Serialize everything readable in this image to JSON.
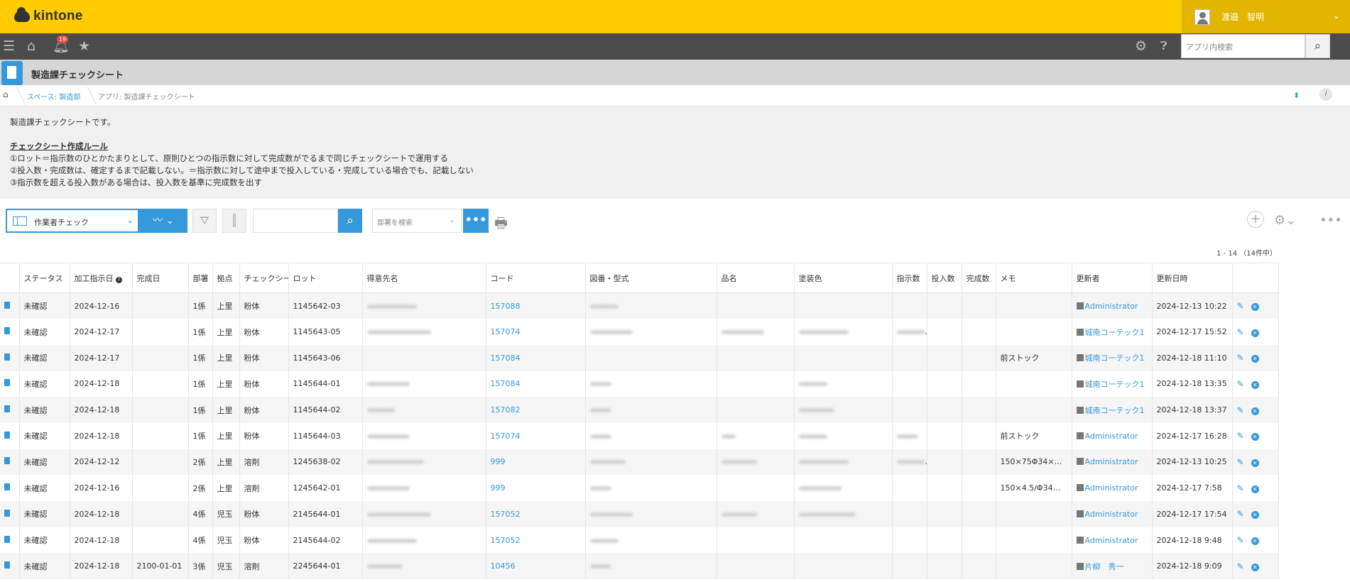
{
  "header": {
    "logo_text": "kintone",
    "user_name": "渡邉　智明"
  },
  "nav": {
    "notification_count": "19",
    "search_placeholder": "アプリ内検索"
  },
  "app": {
    "title": "製造課チェックシート"
  },
  "breadcrumb": {
    "space": "スペース: 製造部",
    "app": "アプリ: 製造課チェックシート"
  },
  "description": {
    "intro": "製造課チェックシートです。",
    "rule_title": "チェックシート作成ルール",
    "rules": [
      "①ロット＝指示数のひとかたまりとして、原則ひとつの指示数に対して完成数がでるまで同じチェックシートで運用する",
      "②投入数・完成数は、確定するまで記載しない。＝指示数に対して途中まで投入している・完成している場合でも、記載しない",
      "③指示数を超える投入数がある場合は、投入数を基準に完成数を出す"
    ]
  },
  "toolbar": {
    "view_name": "作業者チェック",
    "dept_placeholder": "部署を検索",
    "pager": "1 - 14 （14件中）"
  },
  "table": {
    "headers": [
      "ステータス",
      "加工指示日",
      "完成日",
      "部署",
      "拠点",
      "チェックシート",
      "ロット",
      "得意先名",
      "コード",
      "図番・型式",
      "品名",
      "塗装色",
      "指示数",
      "投入数",
      "完成数",
      "メモ",
      "更新者",
      "更新日時"
    ],
    "rows": [
      {
        "status": "未確認",
        "date": "2024-12-16",
        "done": "",
        "dept": "1係",
        "site": "上里",
        "sheet": "粉体",
        "lot": "1145642-03",
        "code": "157088",
        "memo": "",
        "updater": "Administrator",
        "updated": "2024-12-13 10:22"
      },
      {
        "status": "未確認",
        "date": "2024-12-17",
        "done": "",
        "dept": "1係",
        "site": "上里",
        "sheet": "粉体",
        "lot": "1145643-05",
        "code": "157074",
        "memo": "",
        "updater": "城南コーテック1",
        "updated": "2024-12-17 15:52"
      },
      {
        "status": "未確認",
        "date": "2024-12-17",
        "done": "",
        "dept": "1係",
        "site": "上里",
        "sheet": "粉体",
        "lot": "1145643-06",
        "code": "157084",
        "memo": "前ストック",
        "updater": "城南コーテック1",
        "updated": "2024-12-18 11:10"
      },
      {
        "status": "未確認",
        "date": "2024-12-18",
        "done": "",
        "dept": "1係",
        "site": "上里",
        "sheet": "粉体",
        "lot": "1145644-01",
        "code": "157084",
        "memo": "",
        "updater": "城南コーテック1",
        "updated": "2024-12-18 13:35"
      },
      {
        "status": "未確認",
        "date": "2024-12-18",
        "done": "",
        "dept": "1係",
        "site": "上里",
        "sheet": "粉体",
        "lot": "1145644-02",
        "code": "157082",
        "memo": "",
        "updater": "城南コーテック1",
        "updated": "2024-12-18 13:37"
      },
      {
        "status": "未確認",
        "date": "2024-12-18",
        "done": "",
        "dept": "1係",
        "site": "上里",
        "sheet": "粉体",
        "lot": "1145644-03",
        "code": "157074",
        "memo": "前ストック",
        "updater": "Administrator",
        "updated": "2024-12-17 16:28"
      },
      {
        "status": "未確認",
        "date": "2024-12-12",
        "done": "",
        "dept": "2係",
        "site": "上里",
        "sheet": "溶剤",
        "lot": "1245638-02",
        "code": "999",
        "memo": "150×75Φ34×2.…",
        "updater": "Administrator",
        "updated": "2024-12-13 10:25"
      },
      {
        "status": "未確認",
        "date": "2024-12-16",
        "done": "",
        "dept": "2係",
        "site": "上里",
        "sheet": "溶剤",
        "lot": "1245642-01",
        "code": "999",
        "memo": "150×4.5/Φ34×2…",
        "updater": "Administrator",
        "updated": "2024-12-17 7:58"
      },
      {
        "status": "未確認",
        "date": "2024-12-18",
        "done": "",
        "dept": "4係",
        "site": "児玉",
        "sheet": "粉体",
        "lot": "2145644-01",
        "code": "157052",
        "memo": "",
        "updater": "Administrator",
        "updated": "2024-12-17 17:54"
      },
      {
        "status": "未確認",
        "date": "2024-12-18",
        "done": "",
        "dept": "4係",
        "site": "児玉",
        "sheet": "粉体",
        "lot": "2145644-02",
        "code": "157052",
        "memo": "",
        "updater": "Administrator",
        "updated": "2024-12-18 9:48"
      },
      {
        "status": "未確認",
        "date": "2024-12-18",
        "done": "2100-01-01",
        "dept": "3係",
        "site": "児玉",
        "sheet": "溶剤",
        "lot": "2245644-01",
        "code": "10456",
        "memo": "",
        "updater": "片柳　秀一",
        "updated": "2024-12-18 9:09"
      }
    ]
  },
  "colors": {
    "header_yellow": "#ffcc00",
    "user_area": "#e2b500",
    "nav_dark": "#4b4b4b",
    "accent_blue": "#3498db"
  }
}
